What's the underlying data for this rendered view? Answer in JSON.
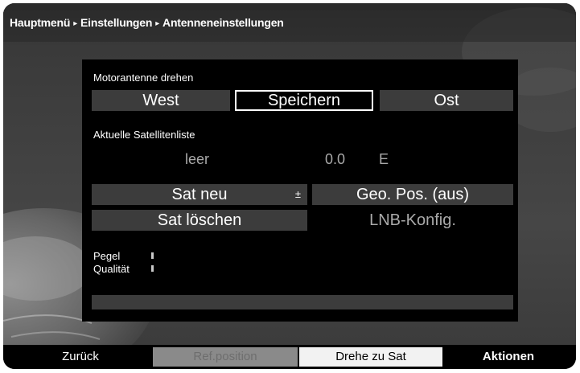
{
  "breadcrumb": {
    "items": [
      "Hauptmenü",
      "Einstellungen",
      "Antenneneinstellungen"
    ],
    "separator": "▸"
  },
  "motor": {
    "label": "Motorantenne drehen",
    "west": "West",
    "save": "Speichern",
    "east": "Ost"
  },
  "satlist": {
    "label": "Aktuelle Satellitenliste",
    "name": "leer",
    "position": "0.0",
    "direction": "E"
  },
  "actions": {
    "sat_new": "Sat neu",
    "plusminus": "±",
    "geo_pos": "Geo. Pos. (aus)",
    "sat_delete": "Sat löschen",
    "lnb_config": "LNB-Konfig."
  },
  "signal": {
    "level_label": "Pegel",
    "quality_label": "Qualität"
  },
  "footer": {
    "back": "Zurück",
    "ref_position": "Ref.position",
    "turn_to_sat": "Drehe zu Sat",
    "actions": "Aktionen"
  },
  "colors": {
    "panel": "#000000",
    "cell": "#3c3c3c",
    "dim_text": "#a9a9a9",
    "footer_red": "#4a4a4a",
    "footer_green": "#8a8a8a",
    "footer_yellow": "#f2f2f2",
    "footer_blue": "#000000"
  }
}
